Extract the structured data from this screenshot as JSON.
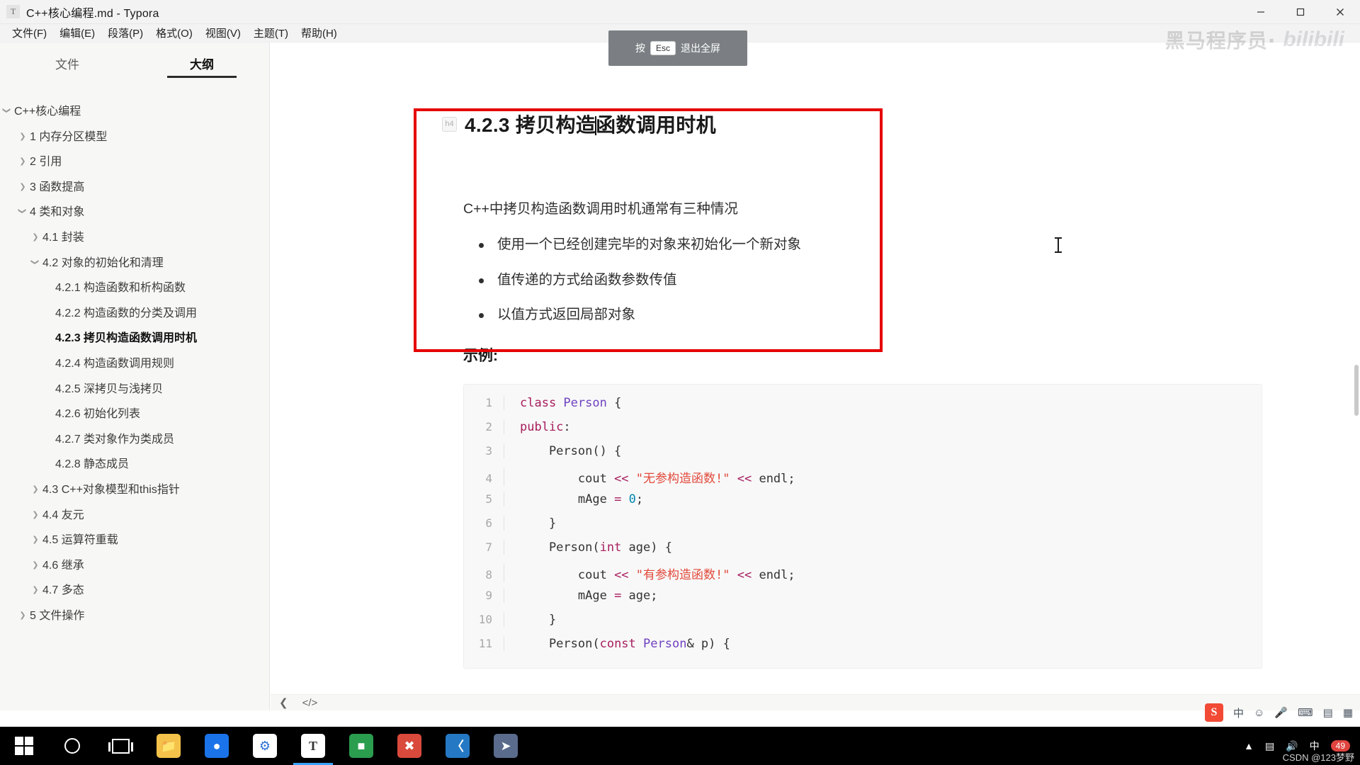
{
  "window": {
    "title": "C++核心编程.md - Typora",
    "app_icon_letter": "T",
    "buttons": {
      "minimize": "minimize-icon",
      "maximize": "maximize-icon",
      "close": "close-icon"
    }
  },
  "menubar": {
    "items": [
      {
        "label": "文件(F)",
        "name": "menu-file"
      },
      {
        "label": "编辑(E)",
        "name": "menu-edit"
      },
      {
        "label": "段落(P)",
        "name": "menu-paragraph"
      },
      {
        "label": "格式(O)",
        "name": "menu-format"
      },
      {
        "label": "视图(V)",
        "name": "menu-view"
      },
      {
        "label": "主题(T)",
        "name": "menu-theme"
      },
      {
        "label": "帮助(H)",
        "name": "menu-help"
      }
    ]
  },
  "sidebar": {
    "tabs": [
      {
        "label": "文件",
        "active": false
      },
      {
        "label": "大纲",
        "active": true
      }
    ],
    "outline": [
      {
        "label": "C++核心编程",
        "level": 0,
        "caret": "down",
        "current": false
      },
      {
        "label": "1 内存分区模型",
        "level": 1,
        "caret": "right",
        "current": false
      },
      {
        "label": "2 引用",
        "level": 1,
        "caret": "right",
        "current": false
      },
      {
        "label": "3 函数提高",
        "level": 1,
        "caret": "right",
        "current": false
      },
      {
        "label": "4 类和对象",
        "level": 1,
        "caret": "down",
        "current": false
      },
      {
        "label": "4.1 封装",
        "level": 2,
        "caret": "right",
        "current": false
      },
      {
        "label": "4.2 对象的初始化和清理",
        "level": 2,
        "caret": "down",
        "current": false
      },
      {
        "label": "4.2.1 构造函数和析构函数",
        "level": 3,
        "caret": "none",
        "current": false
      },
      {
        "label": "4.2.2 构造函数的分类及调用",
        "level": 3,
        "caret": "none",
        "current": false
      },
      {
        "label": "4.2.3 拷贝构造函数调用时机",
        "level": 3,
        "caret": "none",
        "current": true
      },
      {
        "label": "4.2.4 构造函数调用规则",
        "level": 3,
        "caret": "none",
        "current": false
      },
      {
        "label": "4.2.5 深拷贝与浅拷贝",
        "level": 3,
        "caret": "none",
        "current": false
      },
      {
        "label": "4.2.6 初始化列表",
        "level": 3,
        "caret": "none",
        "current": false
      },
      {
        "label": "4.2.7 类对象作为类成员",
        "level": 3,
        "caret": "none",
        "current": false
      },
      {
        "label": "4.2.8 静态成员",
        "level": 3,
        "caret": "none",
        "current": false
      },
      {
        "label": "4.3 C++对象模型和this指针",
        "level": 2,
        "caret": "right",
        "current": false
      },
      {
        "label": "4.4 友元",
        "level": 2,
        "caret": "right",
        "current": false
      },
      {
        "label": "4.5 运算符重载",
        "level": 2,
        "caret": "right",
        "current": false
      },
      {
        "label": "4.6 继承",
        "level": 2,
        "caret": "right",
        "current": false
      },
      {
        "label": "4.7 多态",
        "level": 2,
        "caret": "right",
        "current": false
      },
      {
        "label": "5 文件操作",
        "level": 1,
        "caret": "right",
        "current": false
      }
    ]
  },
  "document": {
    "heading_tag": "h4",
    "heading_before_caret": "4.2.3 拷贝构造",
    "heading_after_caret": "函数调用时机",
    "paragraph": "C++中拷贝构造函数调用时机通常有三种情况",
    "bullets": [
      "使用一个已经创建完毕的对象来初始化一个新对象",
      "值传递的方式给函数参数传值",
      "以值方式返回局部对象"
    ],
    "example_label": "示例:",
    "code_lines": [
      {
        "n": "1",
        "tokens": [
          {
            "t": "class ",
            "c": "kw"
          },
          {
            "t": "Person",
            "c": "typ"
          },
          {
            "t": " {",
            "c": "fn"
          }
        ]
      },
      {
        "n": "2",
        "tokens": [
          {
            "t": "public",
            "c": "kw"
          },
          {
            "t": ":",
            "c": "fn"
          }
        ]
      },
      {
        "n": "3",
        "tokens": [
          {
            "t": "    Person() {",
            "c": "fn"
          }
        ]
      },
      {
        "n": "4",
        "tokens": [
          {
            "t": "        cout ",
            "c": "fn"
          },
          {
            "t": "<<",
            "c": "op"
          },
          {
            "t": " \"无参构造函数!\"",
            "c": "str"
          },
          {
            "t": " <<",
            "c": "op"
          },
          {
            "t": " endl;",
            "c": "fn"
          }
        ]
      },
      {
        "n": "5",
        "tokens": [
          {
            "t": "        mAge ",
            "c": "fn"
          },
          {
            "t": "=",
            "c": "op"
          },
          {
            "t": " ",
            "c": "fn"
          },
          {
            "t": "0",
            "c": "num"
          },
          {
            "t": ";",
            "c": "fn"
          }
        ]
      },
      {
        "n": "6",
        "tokens": [
          {
            "t": "    }",
            "c": "fn"
          }
        ]
      },
      {
        "n": "7",
        "tokens": [
          {
            "t": "    Person(",
            "c": "fn"
          },
          {
            "t": "int",
            "c": "kw"
          },
          {
            "t": " age) {",
            "c": "fn"
          }
        ]
      },
      {
        "n": "8",
        "tokens": [
          {
            "t": "        cout ",
            "c": "fn"
          },
          {
            "t": "<<",
            "c": "op"
          },
          {
            "t": " \"有参构造函数!\"",
            "c": "str"
          },
          {
            "t": " <<",
            "c": "op"
          },
          {
            "t": " endl;",
            "c": "fn"
          }
        ]
      },
      {
        "n": "9",
        "tokens": [
          {
            "t": "        mAge ",
            "c": "fn"
          },
          {
            "t": "=",
            "c": "op"
          },
          {
            "t": " age;",
            "c": "fn"
          }
        ]
      },
      {
        "n": "10",
        "tokens": [
          {
            "t": "    }",
            "c": "fn"
          }
        ]
      },
      {
        "n": "11",
        "tokens": [
          {
            "t": "    Person(",
            "c": "fn"
          },
          {
            "t": "const",
            "c": "kw"
          },
          {
            "t": " Person",
            "c": "typ"
          },
          {
            "t": "& p) {",
            "c": "fn"
          }
        ]
      }
    ]
  },
  "toast": {
    "prefix": "按",
    "key": "Esc",
    "suffix": "退出全屏"
  },
  "watermark": {
    "text": "黑马程序员·",
    "logo": "bilibili"
  },
  "statusbar": {
    "prev_icon": "chevron-left-icon",
    "source_icon": "source-code-icon",
    "note": ""
  },
  "ime": {
    "logo_letter": "S",
    "mode": "中",
    "items": [
      "中",
      "emoji-icon",
      "mic-icon",
      "keyboard-icon",
      "toolbox-icon",
      "grid-icon"
    ]
  },
  "taskbar": {
    "items": [
      {
        "name": "start-button",
        "icon": "windows-logo-icon",
        "color": "#ffffff"
      },
      {
        "name": "search-button",
        "icon": "search-circle-icon",
        "color": "#ffffff"
      },
      {
        "name": "task-view-button",
        "icon": "task-view-icon",
        "color": "#ffffff"
      },
      {
        "name": "file-explorer",
        "icon": "folder-icon",
        "color": "#f6c453",
        "letter": ""
      },
      {
        "name": "browser-app",
        "icon": "browser-icon",
        "color": "#1a6fe0",
        "letter": ""
      },
      {
        "name": "baidu-netdisk",
        "icon": "cloud-disk-icon",
        "color": "#ffffff",
        "letter": ""
      },
      {
        "name": "typora-app",
        "icon": "typora-icon",
        "color": "#ffffff",
        "letter": "T",
        "active": true
      },
      {
        "name": "terminal-app",
        "icon": "terminal-icon",
        "color": "#2a9d4f",
        "letter": ""
      },
      {
        "name": "editor-app",
        "icon": "x-editor-icon",
        "color": "#d94a3d",
        "letter": ""
      },
      {
        "name": "vscode-app",
        "icon": "vscode-icon",
        "color": "#2579c4",
        "letter": ""
      },
      {
        "name": "misc-app",
        "icon": "compass-icon",
        "color": "#5a6b8c",
        "letter": ""
      }
    ],
    "tray": {
      "chevron": "chevron-up-icon",
      "network": "network-icon",
      "volume": "volume-icon",
      "ime_label": "中",
      "badge": "49"
    },
    "csdn": "CSDN @123梦野"
  },
  "colors": {
    "accent_red": "#e60000",
    "sidebar_bg": "#f7f7f5",
    "code_bg": "#f8f8f8",
    "string_color": "#e2493b",
    "keyword_color": "#a71d5d",
    "type_color": "#6f42c1"
  }
}
